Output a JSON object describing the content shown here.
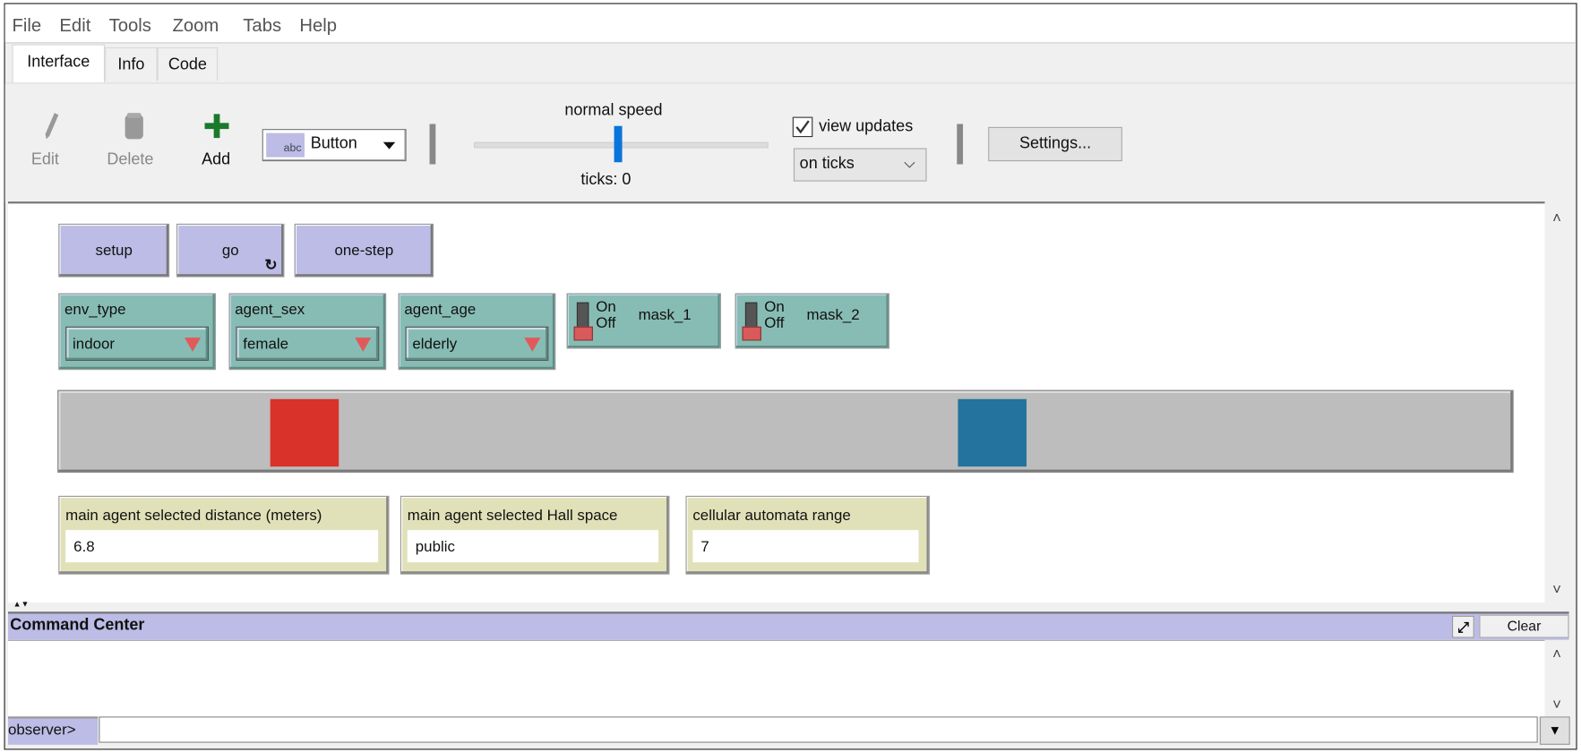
{
  "menu": [
    "File",
    "Edit",
    "Tools",
    "Zoom",
    "Tabs",
    "Help"
  ],
  "tabs": [
    "Interface",
    "Info",
    "Code"
  ],
  "toolbar": {
    "edit_label": "Edit",
    "delete_label": "Delete",
    "add_label": "Add",
    "widget_type": "Button",
    "widget_icon_text": "abc",
    "speed_label": "normal speed",
    "speed_value": 0.5,
    "ticks_label": "ticks: 0",
    "view_updates_label": "view updates",
    "view_updates_checked": true,
    "update_mode": "on ticks",
    "settings_label": "Settings..."
  },
  "buttons": [
    {
      "label": "setup",
      "forever": false
    },
    {
      "label": "go",
      "forever": true
    },
    {
      "label": "one-step",
      "forever": false
    }
  ],
  "choosers": [
    {
      "name": "env_type",
      "value": "indoor"
    },
    {
      "name": "agent_sex",
      "value": "female"
    },
    {
      "name": "agent_age",
      "value": "elderly"
    }
  ],
  "switches": [
    {
      "name": "mask_1",
      "on_label": "On",
      "off_label": "Off",
      "state": "off"
    },
    {
      "name": "mask_2",
      "on_label": "On",
      "off_label": "Off",
      "state": "off"
    }
  ],
  "view": {
    "background": "#bdbdbd",
    "patches": [
      {
        "color": "#d8322a"
      },
      {
        "color": "#23739e"
      }
    ]
  },
  "monitors": [
    {
      "label": "main agent selected distance (meters)",
      "value": "6.8"
    },
    {
      "label": "main agent selected Hall space",
      "value": "public"
    },
    {
      "label": "cellular automata range",
      "value": "7"
    }
  ],
  "command_center": {
    "title": "Command Center",
    "clear_label": "Clear",
    "prompt": "observer>",
    "input_value": ""
  },
  "colors": {
    "button": "#bcbce6",
    "chooser": "#87bcb4",
    "monitor": "#e1e1b9",
    "accent": "#0a74da"
  }
}
